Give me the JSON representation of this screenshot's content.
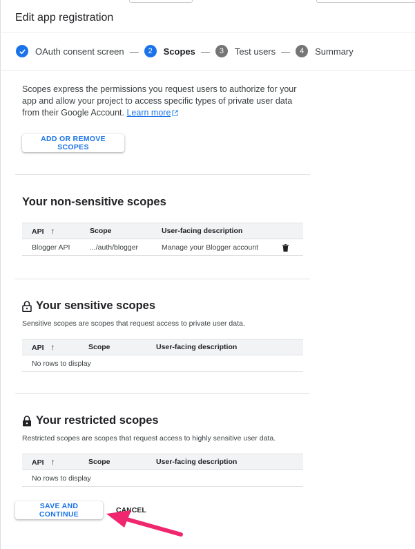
{
  "page": {
    "title": "Edit app registration"
  },
  "stepper": {
    "steps": [
      {
        "number": "✓",
        "label": "OAuth consent screen",
        "state": "done"
      },
      {
        "number": "2",
        "label": "Scopes",
        "state": "active"
      },
      {
        "number": "3",
        "label": "Test users",
        "state": "pending"
      },
      {
        "number": "4",
        "label": "Summary",
        "state": "pending"
      }
    ],
    "separator": "—"
  },
  "intro": {
    "text": "Scopes express the permissions you request users to authorize for your app and allow your project to access specific types of private user data from their Google Account.",
    "link_label": "Learn more"
  },
  "add_scopes_button": "ADD OR REMOVE SCOPES",
  "non_sensitive": {
    "title": "Your non-sensitive scopes",
    "columns": [
      "API",
      "Scope",
      "User-facing description"
    ],
    "rows": [
      {
        "api": "Blogger API",
        "scope": ".../auth/blogger",
        "description": "Manage your Blogger account"
      }
    ]
  },
  "sensitive": {
    "title": "Your sensitive scopes",
    "description": "Sensitive scopes are scopes that request access to private user data.",
    "columns": [
      "API",
      "Scope",
      "User-facing description"
    ],
    "empty": "No rows to display"
  },
  "restricted": {
    "title": "Your restricted scopes",
    "description": "Restricted scopes are scopes that request access to highly sensitive user data.",
    "columns": [
      "API",
      "Scope",
      "User-facing description"
    ],
    "empty": "No rows to display"
  },
  "footer": {
    "save_label": "SAVE AND CONTINUE",
    "cancel_label": "CANCEL"
  },
  "colors": {
    "accent": "#1a73e8",
    "pending_step": "#757575",
    "annotation_arrow": "#f0266e"
  },
  "icons": [
    "check-icon",
    "external-link-icon",
    "sort-arrow-up-icon",
    "trash-icon",
    "lock-open-icon",
    "lock-closed-icon",
    "pointer-arrow-annotation"
  ]
}
